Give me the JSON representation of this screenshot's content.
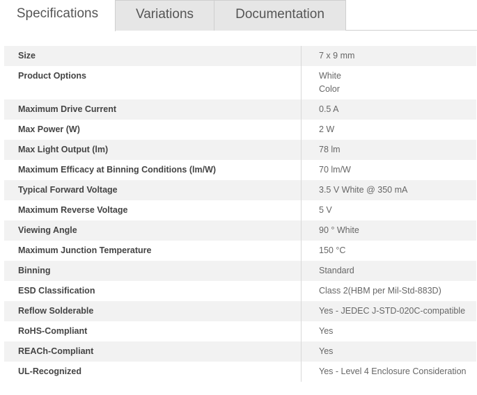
{
  "tabs": [
    {
      "label": "Specifications",
      "active": true
    },
    {
      "label": "Variations",
      "active": false
    },
    {
      "label": "Documentation",
      "active": false
    }
  ],
  "specs": [
    {
      "label": "Size",
      "values": [
        "7 x 9 mm"
      ]
    },
    {
      "label": "Product Options",
      "values": [
        "White",
        "Color"
      ]
    },
    {
      "label": "Maximum Drive Current",
      "values": [
        "0.5 A"
      ]
    },
    {
      "label": "Max Power (W)",
      "values": [
        "2 W"
      ]
    },
    {
      "label": "Max Light Output (lm)",
      "values": [
        "78 lm"
      ]
    },
    {
      "label": "Maximum Efficacy at Binning Conditions (lm/W)",
      "values": [
        "70 lm/W"
      ]
    },
    {
      "label": "Typical Forward Voltage",
      "values": [
        "3.5 V White @ 350 mA"
      ]
    },
    {
      "label": "Maximum Reverse Voltage",
      "values": [
        "5 V"
      ]
    },
    {
      "label": "Viewing Angle",
      "values": [
        "90 ° White"
      ]
    },
    {
      "label": "Maximum Junction Temperature",
      "values": [
        "150 °C"
      ]
    },
    {
      "label": "Binning",
      "values": [
        "Standard"
      ]
    },
    {
      "label": "ESD Classification",
      "values": [
        "Class 2(HBM per Mil-Std-883D)"
      ]
    },
    {
      "label": "Reflow Solderable",
      "values": [
        "Yes - JEDEC J-STD-020C-compatible"
      ]
    },
    {
      "label": "RoHS-Compliant",
      "values": [
        "Yes"
      ]
    },
    {
      "label": "REACh-Compliant",
      "values": [
        "Yes"
      ]
    },
    {
      "label": "UL-Recognized",
      "values": [
        "Yes - Level 4 Enclosure Consideration"
      ]
    }
  ]
}
